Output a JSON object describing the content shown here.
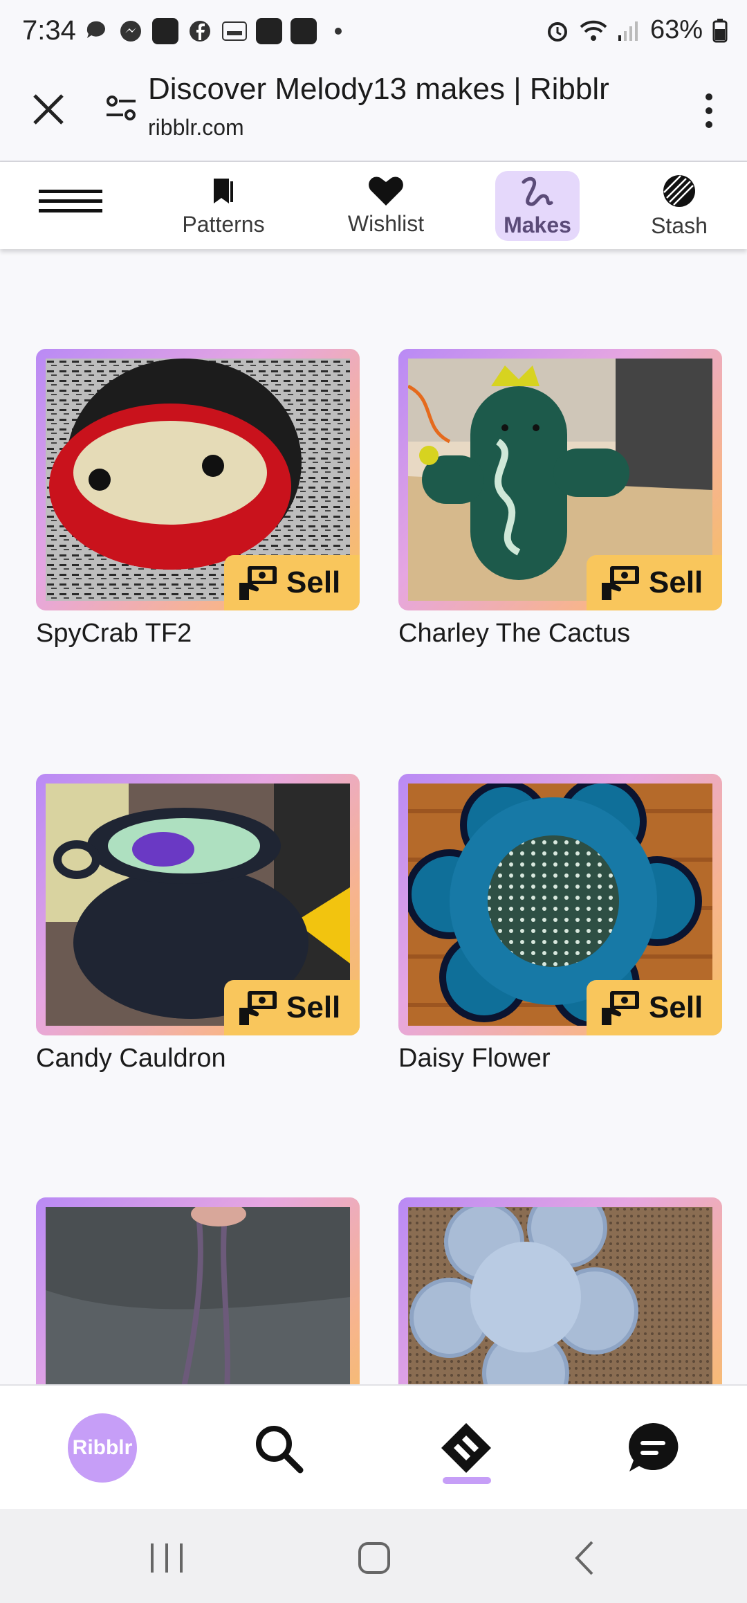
{
  "status": {
    "time": "7:34",
    "battery": "63%"
  },
  "browser": {
    "title": "Discover Melody13 makes | Ribblr",
    "url": "ribblr.com"
  },
  "nav": {
    "tabs": [
      {
        "label": "Patterns",
        "icon": "patterns-bookmark-icon"
      },
      {
        "label": "Wishlist",
        "icon": "heart-icon"
      },
      {
        "label": "Makes",
        "icon": "makes-squiggle-icon",
        "active": true
      },
      {
        "label": "Stash",
        "icon": "yarn-ball-icon"
      }
    ]
  },
  "makes": {
    "sell_label": "Sell",
    "items": [
      {
        "title": "SpyCrab TF2"
      },
      {
        "title": "Charley The Cactus"
      },
      {
        "title": "Candy Cauldron"
      },
      {
        "title": "Daisy Flower"
      },
      {
        "title": ""
      },
      {
        "title": ""
      }
    ]
  },
  "bottom": {
    "logo_text": "Ribblr"
  },
  "colors": {
    "accent": "#c69ef7",
    "sell": "#f9c65c",
    "frame_start": "#b98af5",
    "frame_end": "#f5c15e"
  }
}
